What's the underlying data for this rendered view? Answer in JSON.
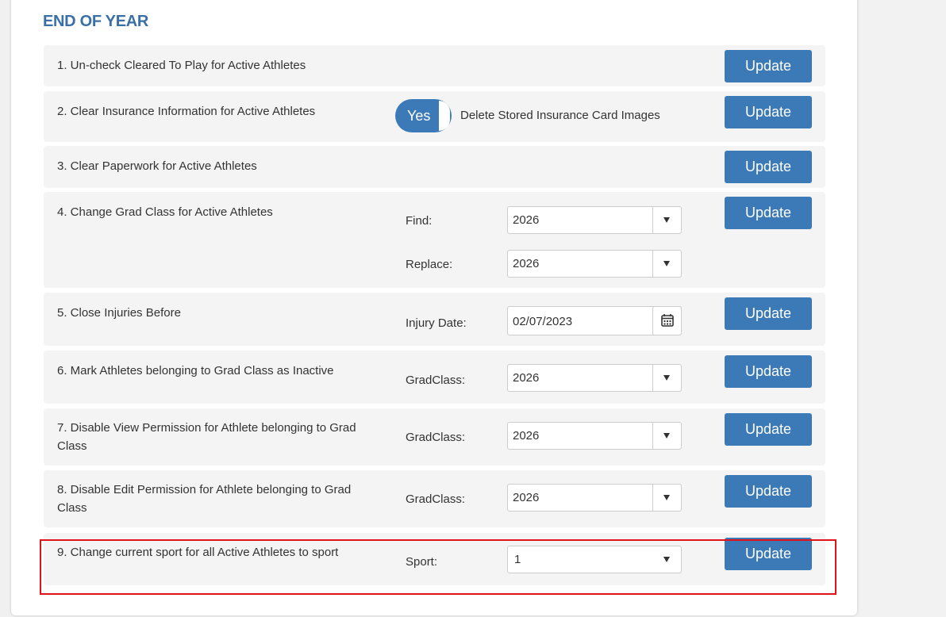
{
  "section": {
    "title": "END OF YEAR"
  },
  "rows": [
    {
      "label": "1. Un-check Cleared To Play for Active Athletes",
      "button": "Update"
    },
    {
      "label": "2. Clear Insurance Information for Active Athletes",
      "toggle_value": "Yes",
      "toggle_label": "Delete Stored Insurance Card Images",
      "button": "Update"
    },
    {
      "label": "3. Clear Paperwork for Active Athletes",
      "button": "Update"
    },
    {
      "label": "4. Change Grad Class for Active Athletes",
      "find_label": "Find:",
      "find_value": "2026",
      "replace_label": "Replace:",
      "replace_value": "2026",
      "button": "Update"
    },
    {
      "label": "5. Close Injuries Before",
      "field_label": "Injury Date:",
      "field_value": "02/07/2023",
      "button": "Update"
    },
    {
      "label": "6. Mark Athletes belonging to Grad Class as Inactive",
      "field_label": "GradClass:",
      "field_value": "2026",
      "button": "Update"
    },
    {
      "label": "7. Disable View Permission for Athlete belonging to Grad Class",
      "field_label": "GradClass:",
      "field_value": "2026",
      "button": "Update"
    },
    {
      "label": "8. Disable Edit Permission for Athlete belonging to Grad Class",
      "field_label": "GradClass:",
      "field_value": "2026",
      "button": "Update"
    },
    {
      "label": "9. Change current sport for all Active Athletes to sport",
      "field_label": "Sport:",
      "field_value": "1",
      "button": "Update"
    }
  ],
  "colors": {
    "accent": "#3b79b7",
    "title": "#3a6fa8",
    "highlight": "#e0131a",
    "row_bg": "#f4f4f4"
  },
  "icons": {
    "calendar": "calendar-icon",
    "dropdown": "chevron-down-icon"
  }
}
